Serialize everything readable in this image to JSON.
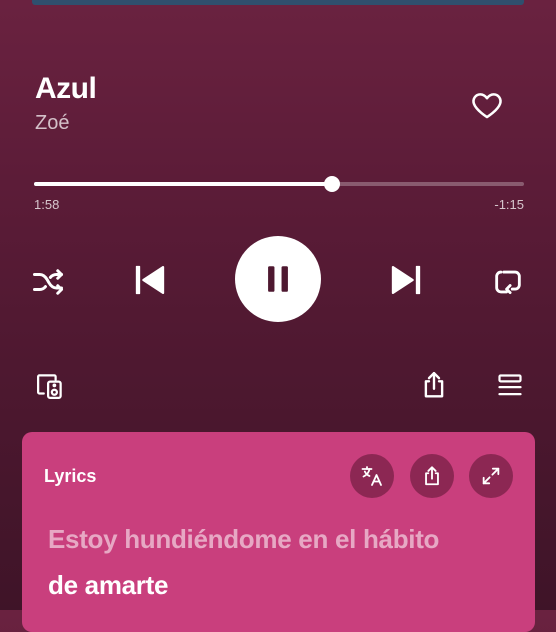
{
  "track": {
    "title": "Azul",
    "artist": "Zoé",
    "elapsed": "1:58",
    "remaining": "-1:15",
    "progress": 0.608
  },
  "controls": {
    "shuffle_icon": "shuffle-icon",
    "previous_icon": "skip-previous-icon",
    "play_pause_icon": "pause-icon",
    "next_icon": "skip-next-icon",
    "repeat_icon": "repeat-icon",
    "devices_icon": "connect-device-icon",
    "share_icon": "share-icon",
    "queue_icon": "queue-icon",
    "like_icon": "heart-icon"
  },
  "lyrics": {
    "label": "Lyrics",
    "translate_icon": "translate-icon",
    "share_icon": "share-icon",
    "expand_icon": "expand-icon",
    "lines": [
      "Estoy hundiéndome en el hábito",
      "de amarte"
    ]
  },
  "colors": {
    "background": "#5c1c38",
    "lyrics_card": "#c93f7d",
    "accent": "#ffffff"
  }
}
